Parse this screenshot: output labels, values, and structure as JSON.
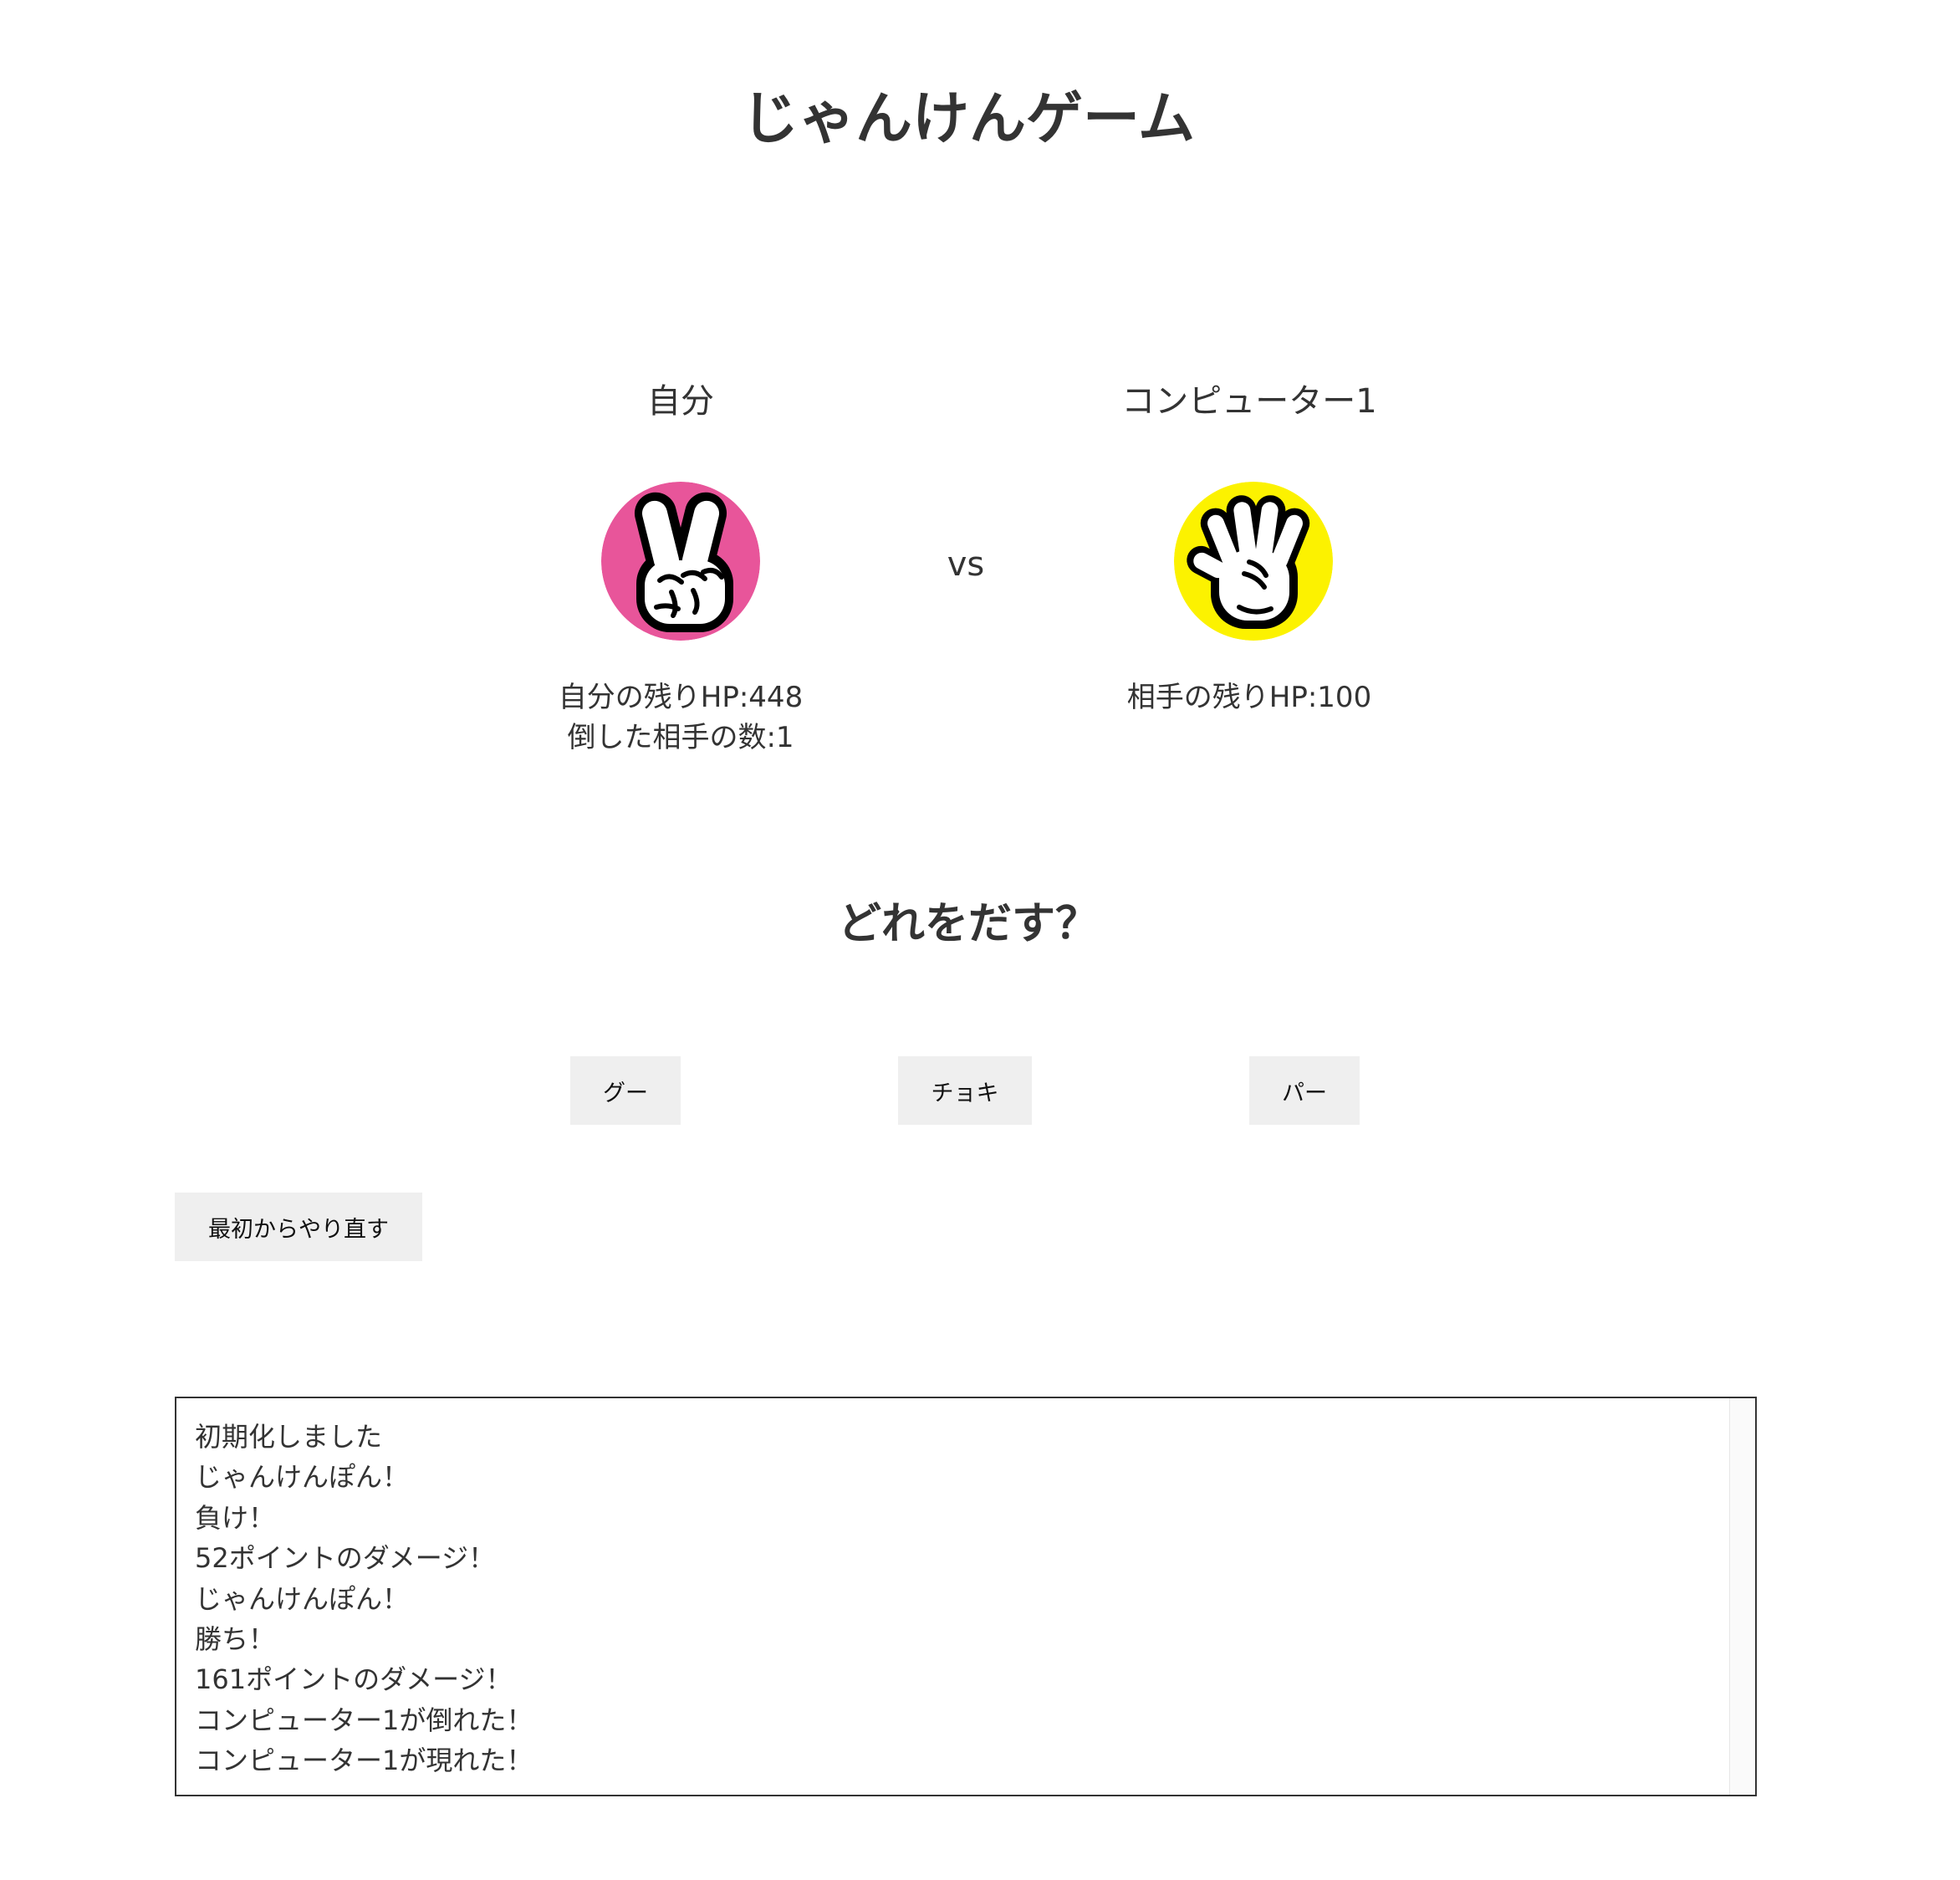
{
  "title": "じゃんけんゲーム",
  "player": {
    "name": "自分",
    "hand_icon": "choki-hand-icon",
    "hand_color": "#e8559a",
    "hp_text": "自分の残りHP:448",
    "defeated_text": "倒した相手の数:1"
  },
  "vs": "vs",
  "enemy": {
    "name": "コンピューター1",
    "hand_icon": "pa-hand-icon",
    "hand_color": "#fcf200",
    "hp_text": "相手の残りHP:100"
  },
  "question": "どれをだす？",
  "buttons": {
    "gu": "グー",
    "choki": "チョキ",
    "pa": "パー",
    "reset": "最初からやり直す"
  },
  "log": [
    "初期化しました",
    "じゃんけんぽん！",
    "負け！",
    "52ポイントのダメージ！",
    "じゃんけんぽん！",
    "勝ち！",
    "161ポイントのダメージ！",
    "コンピューター1が倒れた！",
    "コンピューター1が現れた！"
  ]
}
